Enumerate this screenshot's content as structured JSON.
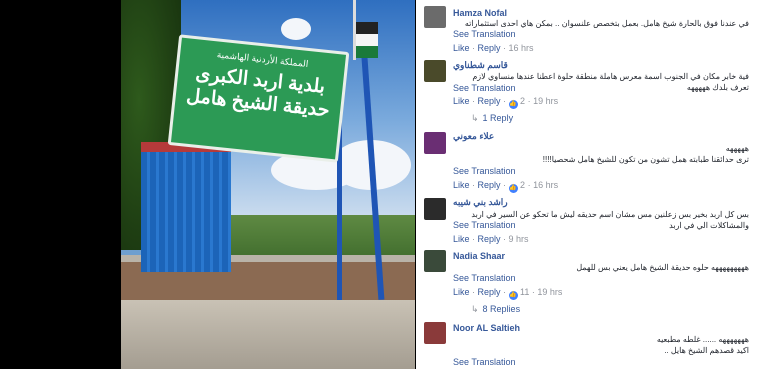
{
  "photo": {
    "sign_line1": "المملكة الأردنية الهاشمية",
    "sign_line2": "بلدية اربد الكبرى",
    "sign_line3": "حديقة الشيخ هامل"
  },
  "actions": {
    "see_translation": "See Translation",
    "like": "Like",
    "reply": "Reply",
    "sep": " · "
  },
  "comments": [
    {
      "name": "Hamza Nofal",
      "text": "في عندنا فوق بالحارة شيخ هامل. بعمل بتخصص علنسوان .. بمكن هاي احدى استثماراته",
      "time": "16 hrs",
      "likes": "",
      "avatar_color": "#6b6b6b"
    },
    {
      "name": "قاسم شطناوي",
      "text": "فية خابر مكان في الجنوب اسمة معرس هاملة منطقة حلوة اعطنا عندها منساوي لازم تعرف بلدك هههههه",
      "time": "19 hrs",
      "likes": "2",
      "replies": "1 Reply",
      "avatar_color": "#4a4a2a"
    },
    {
      "name": "علاء معوني",
      "text_line1": "هههههه",
      "text_line2": "ترى حدائقنا طبابته همل تشون من تكون للشيخ هامل شحصيا!!!!",
      "time": "16 hrs",
      "likes": "2",
      "avatar_color": "#6a2e73"
    },
    {
      "name": "راشد بني شيبه",
      "text": "بس كل اربد بخير بس زعلنين مس مشان اسم حديقه ليش ما تحكو عن السير في اربد والمشاكلات الي في اربد",
      "time": "9 hrs",
      "likes": "",
      "avatar_color": "#2b2b2b"
    },
    {
      "name": "Nadia Shaar",
      "text": "هههههههههه حلوه حديقة الشيخ هامل يعني بس للهمل",
      "time": "19 hrs",
      "likes": "11",
      "replies": "8 Replies",
      "avatar_color": "#3a4a3a"
    },
    {
      "name": "Noor AL Saltieh",
      "text_line1": "هههههههه ...... غلطه مطبعيه",
      "text_line2": "اكيد قصدهم الشيخ هايل ..",
      "avatar_color": "#8a3a3a"
    }
  ]
}
